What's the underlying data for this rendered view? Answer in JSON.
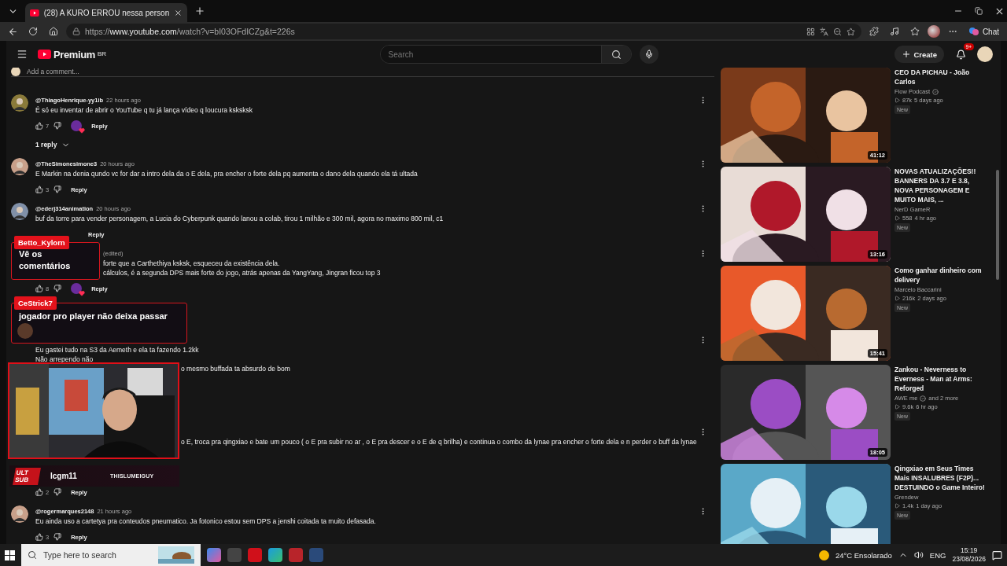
{
  "browser": {
    "tab_title": "(28) A KURO ERROU nessa person",
    "url_prefix": "https://",
    "url_host": "www.youtube.com",
    "url_path": "/watch?v=bI03OFdICZg&t=226s",
    "chat_label": "Chat"
  },
  "header": {
    "logo_text": "Premium",
    "region": "BR",
    "search_placeholder": "Search",
    "create_label": "Create",
    "notification_count": "9+"
  },
  "add_comment_placeholder": "Add a comment...",
  "comments": [
    {
      "kind": "comment",
      "author": "@ThiagoHenrique-yy1ib",
      "time": "22 hours ago",
      "lines": [
        {
          "text": "É só eu inventar de abrir o YouTube q tu já lança vídeo q loucura ksksksk"
        }
      ],
      "likes": "7",
      "hearted": true,
      "reply": "Reply",
      "replies": "1 reply"
    },
    {
      "kind": "comment",
      "author": "@TheSimonesimone3",
      "time": "20 hours ago",
      "lines": [
        {
          "text": "E Markin na denia qundo vc for dar a intro dela da o E dela, pra encher o forte dela pq aumenta o dano dela quando ela tá ultada"
        }
      ],
      "likes": "3",
      "hearted": false,
      "reply": "Reply"
    },
    {
      "kind": "comment",
      "author": "@ederj314animation",
      "time": "20 hours ago",
      "lines": [
        {
          "text": "buf da  torre  para vender personagem, a Lucia do Cyberpunk quando lanou a colab, tirou 1 milhão e 300 mil, agora no maximo 800 mil, c1"
        }
      ],
      "hearted": false,
      "reply": "Reply"
    },
    {
      "kind": "under_chat",
      "time": "(edited)",
      "head_covered": true,
      "lines": [
        {
          "text": "forte que a Carthethiya ksksk, esqueceu da existência dela.",
          "covered": true
        },
        {
          "text": "cálculos, é a segunda DPS mais forte do jogo, atrás apenas da YangYang, Jingran ficou top 3",
          "covered": true
        }
      ],
      "likes": "8",
      "hearted": true,
      "reply": "Reply"
    },
    {
      "kind": "comment",
      "lines": [
        {
          "text": "Eu gastei tudo na S3 da Aemeth e ela ta fazendo 1.2kk",
          "covered": false
        },
        {
          "text": "Não arrependo não",
          "covered": false
        },
        {
          "text": "o mesmo buffada ta absurdo de bom",
          "covered": true
        }
      ]
    },
    {
      "kind": "under_cam",
      "lines": [
        {
          "text": "o E, troca pra qingxiao e bate um pouco ( o E pra subir no ar , o E pra descer e o E de q brilha) e continua o combo da lynae pra encher o forte dela e n perder o buff da lynae",
          "covered": true
        }
      ],
      "likes": "2",
      "hearted": false,
      "reply": "Reply"
    },
    {
      "kind": "comment",
      "author": "@rogermarques2148",
      "time": "21 hours ago",
      "lines": [
        {
          "text": "Eu ainda uso a cartetya pra conteudos pneumatico. Ja fotonico estou sem DPS a jenshi coitada ta muito defasada."
        }
      ],
      "likes": "3",
      "hearted": false,
      "reply": "Reply"
    }
  ],
  "stream_overlay": {
    "chat_messages": [
      {
        "user": "Betto_Kylorn",
        "message": "Vê os comentários"
      },
      {
        "user": "CeStrick7",
        "message": "jogador pro player não deixa passar"
      }
    ],
    "sub_alert": {
      "badge": "ULT SUB",
      "user": "lcgm11",
      "brand": "THISLUMEIGUY"
    }
  },
  "sidebar": {
    "videos": [
      {
        "title": "CEO DA PICHAU - João Carlos",
        "channel": "Flow Podcast",
        "verified": true,
        "views": "87k",
        "age": "5 days ago",
        "badge": "New",
        "duration": "41:12"
      },
      {
        "title": "NOVAS ATUALIZAÇÕES!! BANNERS DA 3.7 E 3.8, NOVA PERSONAGEM E MUITO MAIS, ...",
        "channel": "NerD GameR",
        "verified": false,
        "views": "558",
        "age": "4 hr ago",
        "badge": "New",
        "duration": "13:16"
      },
      {
        "title": "Como ganhar dinheiro com delivery",
        "channel": "Marcelo Baccarini",
        "verified": false,
        "views": "216k",
        "age": "2 days ago",
        "badge": "New",
        "duration": "15:41"
      },
      {
        "title": "Zankou - Neverness to Everness - Man at Arms: Reforged",
        "channel": "AWE me",
        "verified": true,
        "extra": "and 2 more",
        "views": "9.6k",
        "age": "6 hr ago",
        "badge": "New",
        "duration": "18:05"
      },
      {
        "title": "Qingxiao em Seus Times Mais INSALUBRES (F2P)... DESTUINDO o Game Inteiro!",
        "channel": "Grendew",
        "verified": false,
        "views": "1.4k",
        "age": "1 day ago",
        "badge": "New"
      }
    ]
  },
  "taskbar": {
    "search_placeholder": "Type here to search",
    "weather": "24°C  Ensolarado",
    "language": "ENG",
    "time": "15:19",
    "date": "23/08/2026"
  }
}
